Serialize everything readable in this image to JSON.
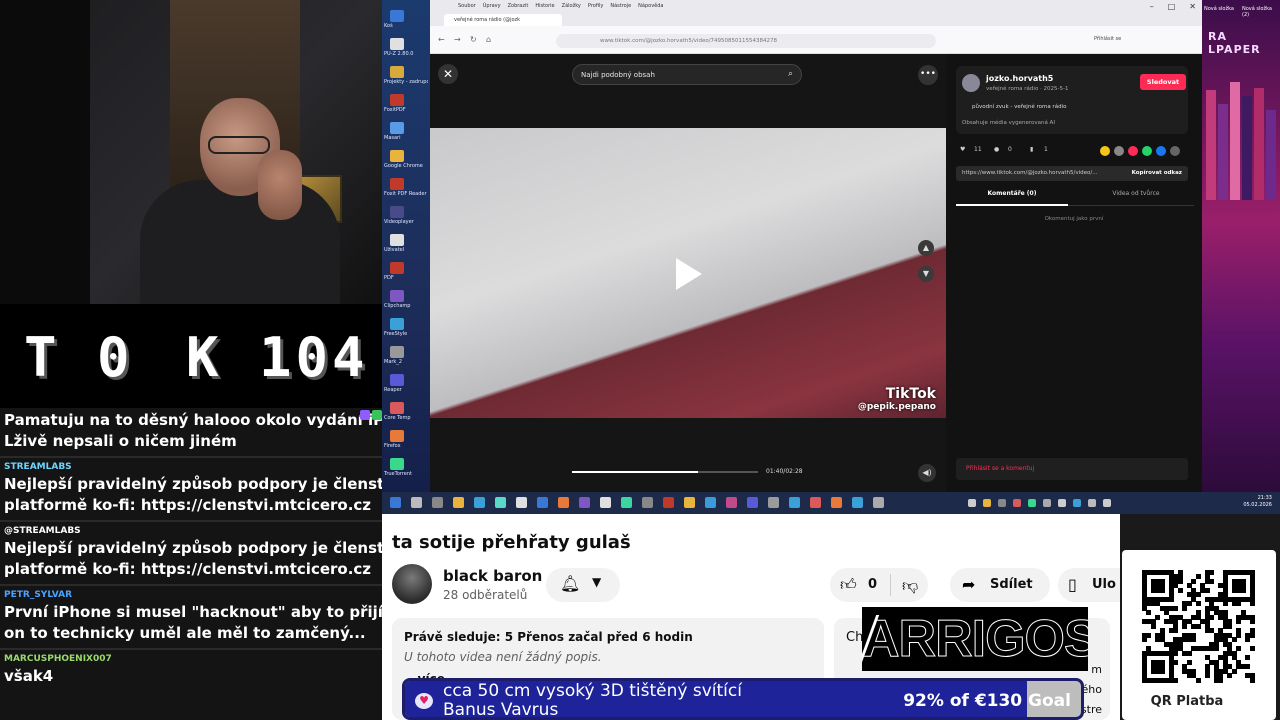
{
  "counter": {
    "left": "T 0",
    "right": "K 104"
  },
  "chat": [
    {
      "user": "",
      "user_color": "#00d0ff",
      "text_lines": [
        "Pamatuju na to děsný halooo okolo vydání iPhone, na",
        "Lživě nepsali o ničem jiném"
      ]
    },
    {
      "user": "STREAMLABS",
      "user_color": "#6dd6ff",
      "text_lines": [
        "Nejlepší pravidelný způsob podpory je členství na",
        "platformě ko-fi: https://clenstvi.mtcicero.cz"
      ]
    },
    {
      "user": "@STREAMLABS",
      "user_color": "#ffffff",
      "text_lines": [
        "Nejlepší pravidelný způsob podpory je členství na",
        "platformě ko-fi: https://clenstvi.mtcicero.cz"
      ]
    },
    {
      "user": "PETR_SYLVAR",
      "user_color": "#4aa3ff",
      "text_lines": [
        "První iPhone si musel \"hacknout\" aby to přijímalo GSM",
        "on to technicky uměl ale měl to zamčený..."
      ]
    },
    {
      "user": "MARCUSPHOENIX007",
      "user_color": "#9bd86e",
      "text_lines": [
        "však4"
      ]
    }
  ],
  "browser": {
    "menu": [
      "Soubor",
      "Úpravy",
      "Zobrazit",
      "Historie",
      "Záložky",
      "Profily",
      "Nástroje",
      "Nápověda"
    ],
    "tab_title": "veřejné roma rádio (@jozk",
    "url": "www.tiktok.com/@jozko.horvath5/video/7495085011554384278",
    "login_link": "Přihlásit se"
  },
  "tiktok": {
    "search_placeholder": "Najdi podobný obsah",
    "watermark_brand": "TikTok",
    "watermark_handle": "@pepik.pepano",
    "time": "01:40/02:28",
    "progress": 0.68,
    "author": "jozko.horvath5",
    "author_sub": "veřejné roma rádio · 2025-5-1",
    "music": "původní zvuk - veřejné roma rádio",
    "ai_note": "Obsahuje média vygenerovaná AI",
    "follow_label": "Sledovat",
    "likes": "11",
    "comments": "0",
    "saves": "1",
    "share_link": "https://www.tiktok.com/@jozko.horvath5/video/...",
    "copy_label": "Kopírovat odkaz",
    "tab_comments": "Komentáře (0)",
    "tab_creator": "Videa od tvůrce",
    "no_comments": "Okomentuj jako první",
    "login_comment": "Přihlásit se a komentuj"
  },
  "desktop": {
    "right_title": "RA LPAPER",
    "right_labels": [
      "Nová složka",
      "Nová složka (2)"
    ],
    "left_labels": [
      "Koš",
      "PU-Z 2.80.0",
      "Projekty - zadrupce",
      "FoxitPDF",
      "Masari",
      "Google Chrome",
      "Foxit PDF Reader",
      "Videoplayer",
      "Uživatel",
      "PDF",
      "Clipchamp",
      "FreeStyle",
      "Mark_2",
      "Reaper",
      "Core Temp",
      "Firefox",
      "TrueTorrent"
    ],
    "clock_time": "21:33",
    "clock_date": "05.02.2026"
  },
  "youtube": {
    "title": "ta sotije přehřaty gulaš",
    "channel": "black baron",
    "subscribers": "28 odběratelů",
    "likes": "0",
    "share_label": "Sdílet",
    "save_label": "Ulo",
    "watching": "Právě sleduje: 5  Přenos začal před 6 hodin",
    "no_desc": "U tohoto videa není žádný popis.",
    "more": "...více",
    "chat_card_title": "Ch",
    "chat_card_line1": "m",
    "chat_card_line2": "živého",
    "chat_card_line3": "stre"
  },
  "overlay": {
    "logo_text": "ARRIGOS",
    "goal_line1": "cca 50 cm vysoký 3D tištěný svítící",
    "goal_line2": "Banus Vavrus",
    "goal_pct": 0.92,
    "goal_text": "92% of €130 Goal",
    "qr_label": "QR Platba"
  },
  "colors": {
    "tiktok_accent": "#fe2c55",
    "goal_fill": "#1e2399",
    "youtube_bg": "#ffffff"
  }
}
